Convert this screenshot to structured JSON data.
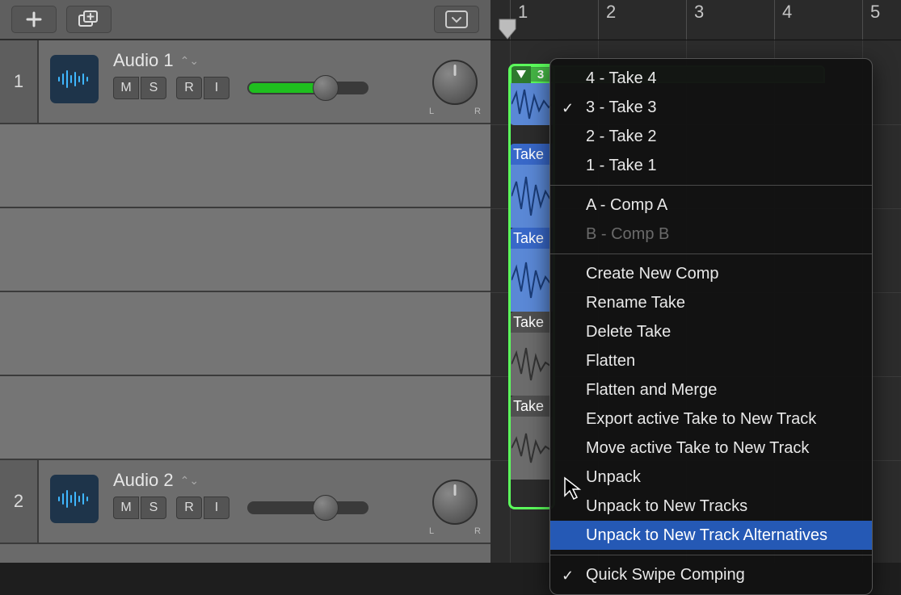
{
  "ruler": {
    "ticks": [
      "1",
      "2",
      "3",
      "4",
      "5"
    ]
  },
  "tracks": [
    {
      "num": "1",
      "name": "Audio 1",
      "buttons": {
        "m": "M",
        "s": "S",
        "r": "R",
        "i": "I"
      },
      "pan_l": "L",
      "pan_r": "R",
      "vol_fill_pct": 58,
      "vol_knob_pct": 58
    },
    {
      "num": "2",
      "name": "Audio 2",
      "buttons": {
        "m": "M",
        "s": "S",
        "r": "R",
        "i": "I"
      },
      "pan_l": "L",
      "pan_r": "R",
      "vol_fill_pct": 0,
      "vol_knob_pct": 58
    }
  ],
  "region": {
    "disclosure_num": "3",
    "take_prefix": "Take"
  },
  "takes": [
    {
      "label": "Take",
      "active": true
    },
    {
      "label": "Take",
      "active": true
    },
    {
      "label": "Take",
      "active": false
    },
    {
      "label": "Take",
      "active": false
    }
  ],
  "menu": {
    "takes": [
      {
        "label": "4 - Take 4",
        "checked": false
      },
      {
        "label": "3 - Take 3",
        "checked": true
      },
      {
        "label": "2 - Take 2",
        "checked": false
      },
      {
        "label": "1 - Take 1",
        "checked": false
      }
    ],
    "comps": [
      {
        "label": "A - Comp A",
        "disabled": false
      },
      {
        "label": "B - Comp B",
        "disabled": true
      }
    ],
    "actions": [
      "Create New Comp",
      "Rename Take",
      "Delete Take",
      "Flatten",
      "Flatten and Merge",
      "Export active Take to New Track",
      "Move active Take to New Track",
      "Unpack",
      "Unpack to New Tracks",
      "Unpack to New Track Alternatives"
    ],
    "highlight_action_index": 9,
    "footer": {
      "label": "Quick Swipe Comping",
      "checked": true
    }
  }
}
